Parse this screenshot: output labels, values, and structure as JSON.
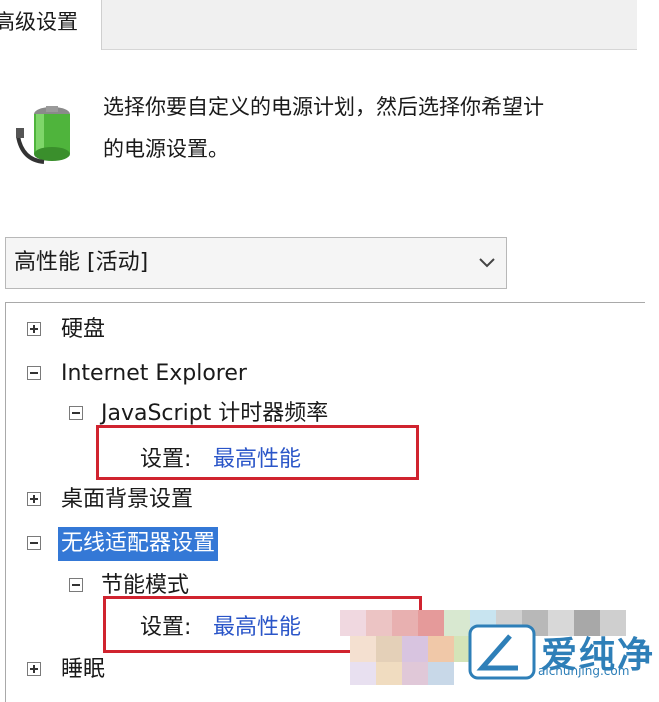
{
  "tabs": {
    "advanced_label": "高级设置"
  },
  "intro": {
    "line1": "选择你要自定义的电源计划，然后选择你希望计",
    "line2": "的电源设置。"
  },
  "plan_select": {
    "value": "高性能 [活动]"
  },
  "tree": {
    "hard_disk": "硬盘",
    "ie": "Internet Explorer",
    "js_timer": "JavaScript 计时器频率",
    "setting_label": "设置:",
    "setting_value": "最高性能",
    "desktop_bg": "桌面背景设置",
    "wireless": "无线适配器设置",
    "power_mode": "节能模式",
    "sleep": "睡眠"
  },
  "watermark": {
    "brand": "爱纯净",
    "url": "aichunjing.com"
  },
  "colors": {
    "link": "#2a55c8",
    "selection": "#3478d6",
    "callout": "#d0232f"
  }
}
